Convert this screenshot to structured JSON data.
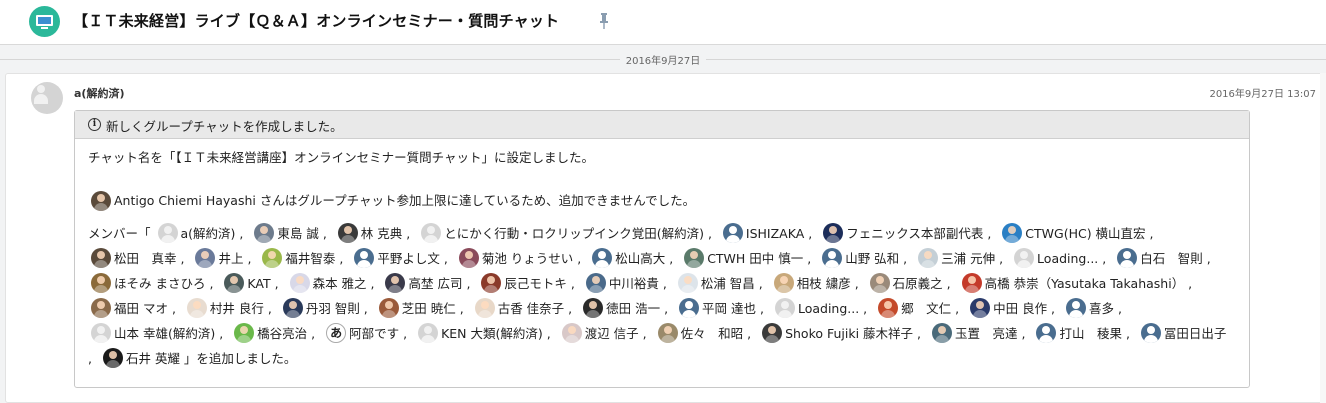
{
  "header": {
    "title": "【ＩＴ未来経営】ライブ【Ｑ＆Ａ】オンラインセミナー・質問チャット",
    "room_icon": "room-icon",
    "pin_icon": "pin-icon",
    "accent_color": "#2bb89a"
  },
  "date_separator": "2016年9月27日",
  "message": {
    "sender": "a(解約済)",
    "timestamp": "2016年9月27日 13:07",
    "notice_title": "新しくグループチャットを作成しました。",
    "line_name": "チャット名を「【ＩＴ未来経営講座】オンラインセミナー質問チャット」に設定しました。",
    "limit_user": "Antigo Chiemi Hayashi",
    "limit_text": "さんはグループチャット参加上限に達しているため、追加できませんでした。",
    "members_prefix": "メンバー「",
    "members_suffix": "」を追加しました。",
    "members": [
      {
        "name": "a(解約済)",
        "avatar": "grey"
      },
      {
        "name": "東島 誠",
        "avatar": "photo",
        "color": "#6d7b8c"
      },
      {
        "name": "林 克典",
        "avatar": "photo",
        "color": "#3a3a3a"
      },
      {
        "name": "とにかく行動・ロクリップインク覚田(解約済)",
        "avatar": "grey"
      },
      {
        "name": "ISHIZAKA",
        "avatar": "default"
      },
      {
        "name": "フェニックス本部副代表",
        "avatar": "photo",
        "color": "#1c2d5a"
      },
      {
        "name": "CTWG(HC) 横山直宏",
        "avatar": "photo",
        "color": "#2a7fc4"
      },
      {
        "name": "松田　真幸",
        "avatar": "photo",
        "color": "#5a4a3a"
      },
      {
        "name": "井上",
        "avatar": "photo",
        "color": "#6a7a9a"
      },
      {
        "name": "福井智泰",
        "avatar": "photo",
        "color": "#9ab84a"
      },
      {
        "name": "平野よし文",
        "avatar": "default"
      },
      {
        "name": "菊池 りょうせい",
        "avatar": "photo",
        "color": "#8a4a5a"
      },
      {
        "name": "松山高大",
        "avatar": "default"
      },
      {
        "name": "CTWH 田中 慎一",
        "avatar": "photo",
        "color": "#5a7a6a"
      },
      {
        "name": "山野 弘和",
        "avatar": "default"
      },
      {
        "name": "三浦 元伸",
        "avatar": "photo",
        "color": "#c4cfd6"
      },
      {
        "name": "Loading...",
        "avatar": "grey"
      },
      {
        "name": "白石　智則",
        "avatar": "default"
      },
      {
        "name": "ほそみ まさひろ",
        "avatar": "photo",
        "color": "#8a6a3a"
      },
      {
        "name": "KAT",
        "avatar": "photo",
        "color": "#4a5a5a"
      },
      {
        "name": "森本 雅之",
        "avatar": "photo",
        "color": "#d8d8e8"
      },
      {
        "name": "高埜 広司",
        "avatar": "photo",
        "color": "#3a3a4a"
      },
      {
        "name": "辰己モトキ",
        "avatar": "photo",
        "color": "#8a3a2a"
      },
      {
        "name": "中川裕貴",
        "avatar": "photo",
        "color": "#4a6a8a"
      },
      {
        "name": "松浦 智昌",
        "avatar": "photo",
        "color": "#dde4ea"
      },
      {
        "name": "相枝 繍彦",
        "avatar": "photo",
        "color": "#c8a87a"
      },
      {
        "name": "石原義之",
        "avatar": "photo",
        "color": "#9a8a7a"
      },
      {
        "name": "高橋 恭崇（Yasutaka Takahashi）",
        "avatar": "photo",
        "color": "#c43a2a"
      },
      {
        "name": "福田 マオ",
        "avatar": "photo",
        "color": "#8a6a4a"
      },
      {
        "name": "村井 良行",
        "avatar": "photo",
        "color": "#e8dcd0"
      },
      {
        "name": "丹羽 智則",
        "avatar": "photo",
        "color": "#2a3a5a"
      },
      {
        "name": "芝田 暁仁",
        "avatar": "photo",
        "color": "#9a5a3a"
      },
      {
        "name": "古香 佳奈子",
        "avatar": "photo",
        "color": "#e8d8c8"
      },
      {
        "name": "徳田 浩一",
        "avatar": "photo",
        "color": "#2a2a2a"
      },
      {
        "name": "平岡 達也",
        "avatar": "default"
      },
      {
        "name": "Loading...",
        "avatar": "grey"
      },
      {
        "name": "郷　文仁",
        "avatar": "photo",
        "color": "#c44a2a"
      },
      {
        "name": "中田 良作",
        "avatar": "photo",
        "color": "#2a3a6a"
      },
      {
        "name": "喜多",
        "avatar": "default"
      },
      {
        "name": "山本 幸雄(解約済)",
        "avatar": "grey"
      },
      {
        "name": "橋谷亮治",
        "avatar": "photo",
        "color": "#6ab84a"
      },
      {
        "name": "阿部です",
        "avatar": "char",
        "char": "あ"
      },
      {
        "name": "KEN 大類(解約済)",
        "avatar": "grey"
      },
      {
        "name": "渡辺 信子",
        "avatar": "photo",
        "color": "#d8c8c8"
      },
      {
        "name": "佐々　和昭",
        "avatar": "photo",
        "color": "#9a8a6a"
      },
      {
        "name": "Shoko Fujiki 藤木祥子",
        "avatar": "photo",
        "color": "#3a3a3a"
      },
      {
        "name": "玉置　亮達",
        "avatar": "photo",
        "color": "#4a6a7a"
      },
      {
        "name": "打山　稜果",
        "avatar": "default"
      },
      {
        "name": "冨田日出子",
        "avatar": "default"
      },
      {
        "name": "石井 英耀",
        "avatar": "photo",
        "color": "#1a1a1a"
      }
    ]
  }
}
